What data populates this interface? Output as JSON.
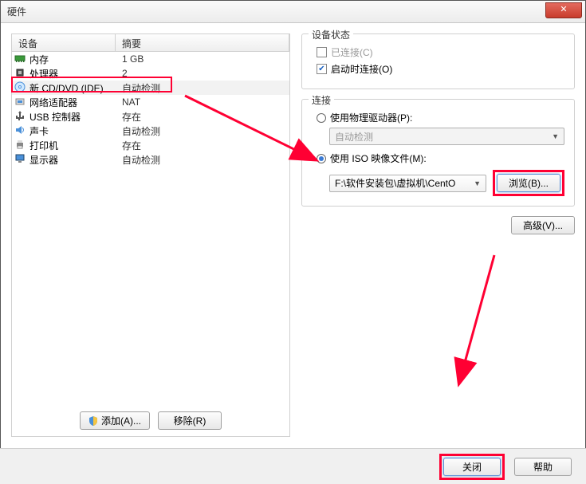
{
  "window": {
    "title": "硬件"
  },
  "device_table": {
    "headers": {
      "device": "设备",
      "summary": "摘要"
    },
    "rows": [
      {
        "name": "内存",
        "summary": "1 GB",
        "icon": "memory"
      },
      {
        "name": "处理器",
        "summary": "2",
        "icon": "cpu"
      },
      {
        "name": "新 CD/DVD (IDE)",
        "summary": "自动检测",
        "icon": "disc",
        "selected": true
      },
      {
        "name": "网络适配器",
        "summary": "NAT",
        "icon": "nic"
      },
      {
        "name": "USB 控制器",
        "summary": "存在",
        "icon": "usb"
      },
      {
        "name": "声卡",
        "summary": "自动检测",
        "icon": "sound"
      },
      {
        "name": "打印机",
        "summary": "存在",
        "icon": "printer"
      },
      {
        "name": "显示器",
        "summary": "自动检测",
        "icon": "display"
      }
    ]
  },
  "left_buttons": {
    "add": "添加(A)...",
    "remove": "移除(R)"
  },
  "status_group": {
    "legend": "设备状态",
    "connected": {
      "label": "已连接(C)",
      "checked": false,
      "disabled": true
    },
    "connect_at_power": {
      "label": "启动时连接(O)",
      "checked": true
    }
  },
  "connection_group": {
    "legend": "连接",
    "physical": {
      "label": "使用物理驱动器(P):",
      "selected": false
    },
    "physical_combo": {
      "value": "自动检测",
      "disabled": true
    },
    "iso": {
      "label": "使用 ISO 映像文件(M):",
      "selected": true
    },
    "iso_path": "F:\\软件安装包\\虚拟机\\CentO",
    "browse_btn": "浏览(B)..."
  },
  "advanced_btn": "高级(V)...",
  "footer": {
    "close": "关闭",
    "help": "帮助"
  }
}
